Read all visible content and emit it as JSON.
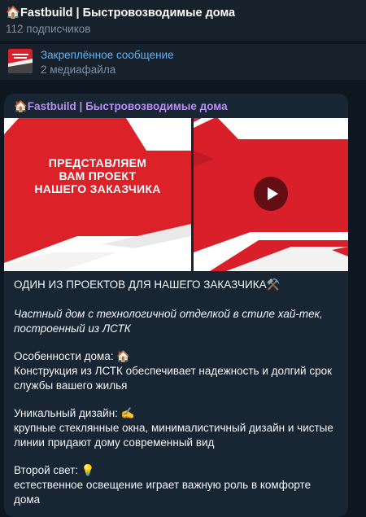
{
  "header": {
    "title": "🏠Fastbuild | Быстровозводимые дома",
    "subscribers": "112 подписчиков"
  },
  "pinned": {
    "label": "Закреплённое сообщение",
    "meta": "2 медиафайла"
  },
  "post": {
    "author": "🏠Fastbuild | Быстровозводимые дома",
    "media": {
      "promo_lines": [
        "ПРЕДСТАВЛЯЕМ",
        "ВАМ ПРОЕКТ",
        "НАШЕГО ЗАКАЗЧИКА"
      ]
    },
    "headline": "ОДИН ИЗ ПРОЕКТОВ ДЛЯ НАШЕГО ЗАКАЗЧИКА⚒️",
    "subtitle": "Частный дом с технологичной отделкой в стиле хай-тек, построенный из ЛСТК",
    "sections": [
      {
        "title": "Особенности дома: 🏠",
        "text": "Конструкция из ЛСТК обеспечивает надежность и долгий срок службы вашего жилья"
      },
      {
        "title": "Уникальный дизайн: ✍️",
        "text": "крупные стеклянные окна, минималистичный дизайн и чистые линии придают дому современный вид"
      },
      {
        "title": "Второй свет: 💡",
        "text": "естественное освещение играет важную роль в комфорте дома"
      }
    ]
  },
  "colors": {
    "background": "#0e1621",
    "panel": "#17212b",
    "bubble": "#182533",
    "accent_blue": "#5eb5f7",
    "author_purple": "#b88ff0",
    "muted": "#7f91a4",
    "brand_red": "#dd2128"
  },
  "icons": {
    "play": "play-icon"
  }
}
